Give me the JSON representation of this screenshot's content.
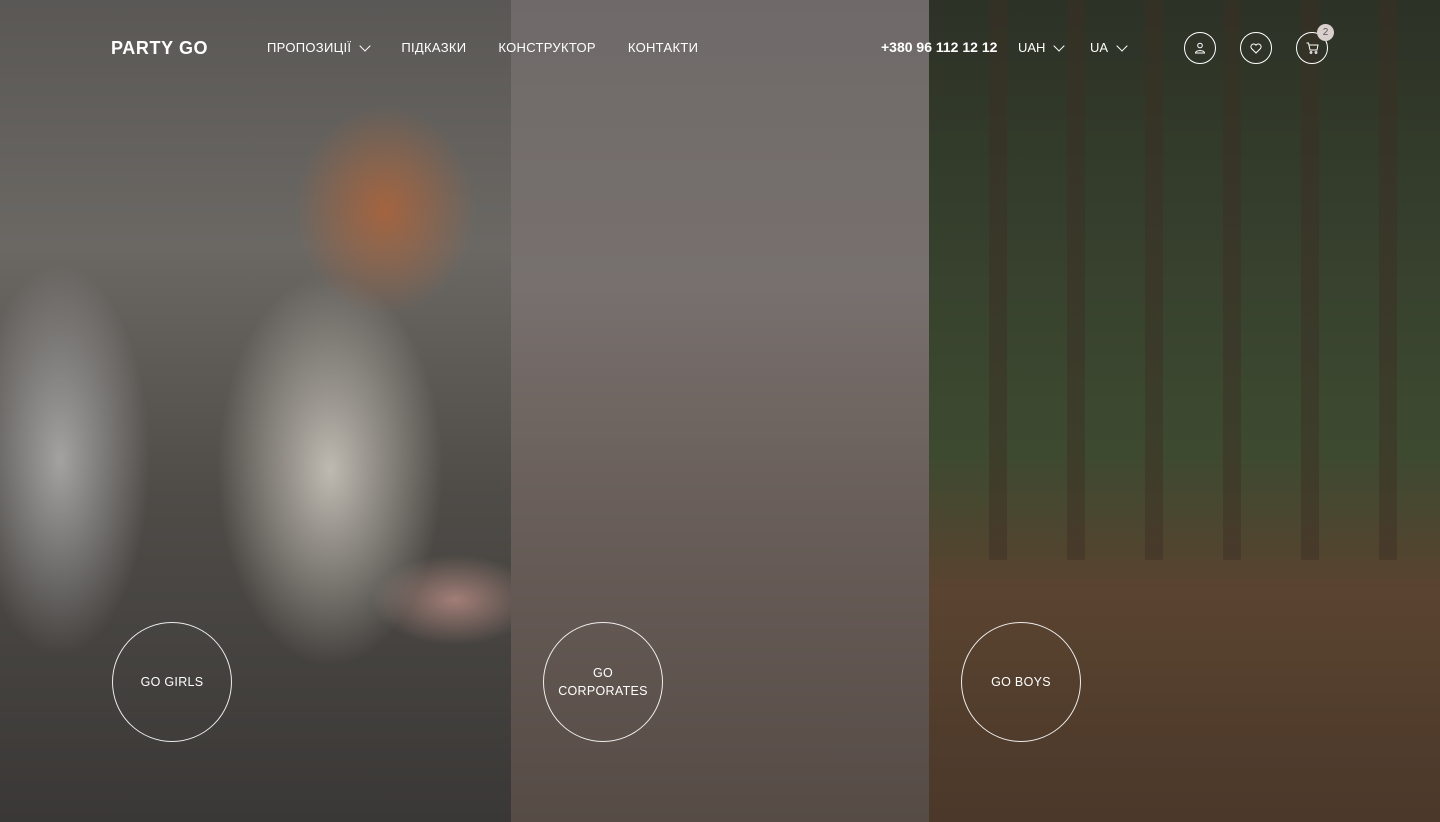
{
  "header": {
    "logo": "PARTY GO",
    "nav": [
      {
        "label": "ПРОПОЗИЦІЇ",
        "has_dropdown": true
      },
      {
        "label": "ПІДКАЗКИ"
      },
      {
        "label": "КОНСТРУКТОР"
      },
      {
        "label": "КОНТАКТИ"
      }
    ],
    "phone": "+380 96 112 12 12",
    "currency": "UAH",
    "language": "UA",
    "icons": [
      "user-icon",
      "heart-icon",
      "cart-icon"
    ],
    "cart_count": "2"
  },
  "panels": [
    {
      "label": "GO GIRLS"
    },
    {
      "label": "GO CORPORATES"
    },
    {
      "label": "GO BOYS"
    }
  ],
  "colors": {
    "text": "#ffffff",
    "badge_bg": "#d9cfcc"
  }
}
